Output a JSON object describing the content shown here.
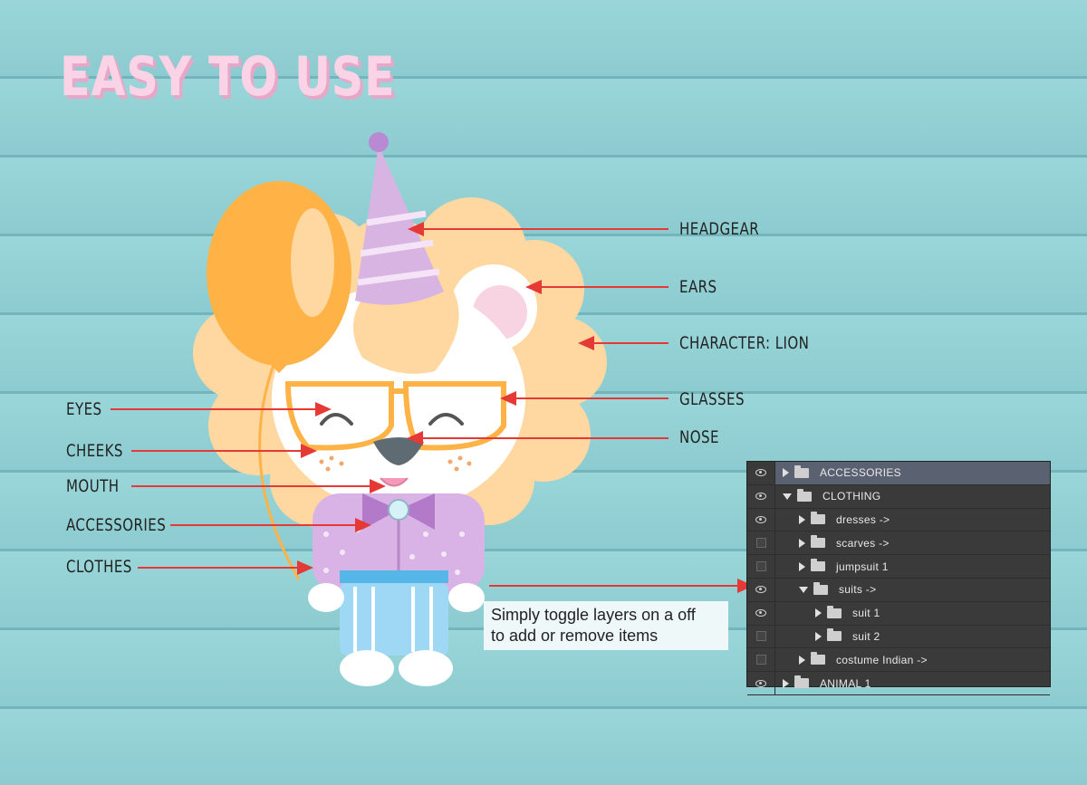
{
  "title": "EASY TO USE",
  "labels": {
    "headgear": "HEADGEAR",
    "ears": "EARS",
    "character": "CHARACTER: LION",
    "glasses": "GLASSES",
    "nose": "NOSE",
    "eyes": "EYES",
    "cheeks": "CHEEKS",
    "mouth": "MOUTH",
    "accessories": "ACCESSORIES",
    "clothes": "CLOTHES"
  },
  "tip": {
    "line1": "Simply toggle layers on a off",
    "line2": "to add or remove items"
  },
  "layers": [
    {
      "name": "ACCESSORIES",
      "visible": true,
      "level": 0,
      "expanded": false,
      "selected": true
    },
    {
      "name": "CLOTHING",
      "visible": true,
      "level": 0,
      "expanded": true,
      "selected": false
    },
    {
      "name": "dresses ->",
      "visible": true,
      "level": 1,
      "expanded": false,
      "selected": false
    },
    {
      "name": "scarves ->",
      "visible": false,
      "level": 1,
      "expanded": false,
      "selected": false
    },
    {
      "name": "jumpsuit 1",
      "visible": false,
      "level": 1,
      "expanded": false,
      "selected": false
    },
    {
      "name": "suits ->",
      "visible": true,
      "level": 1,
      "expanded": true,
      "selected": false
    },
    {
      "name": "suit 1",
      "visible": true,
      "level": 2,
      "expanded": false,
      "selected": false
    },
    {
      "name": "suit 2",
      "visible": false,
      "level": 2,
      "expanded": false,
      "selected": false
    },
    {
      "name": "costume Indian ->",
      "visible": false,
      "level": 1,
      "expanded": false,
      "selected": false
    },
    {
      "name": "ANIMAL 1",
      "visible": true,
      "level": 0,
      "expanded": false,
      "selected": false
    }
  ],
  "colors": {
    "background": "#93d1d5",
    "title": "#fbd3e6",
    "arrow": "#e53935",
    "mane": "#ffd7a0",
    "balloon": "#ffb347",
    "hat": "#d8b4e2",
    "shirt": "#d9b3e6",
    "pants": "#9ed8f5"
  }
}
